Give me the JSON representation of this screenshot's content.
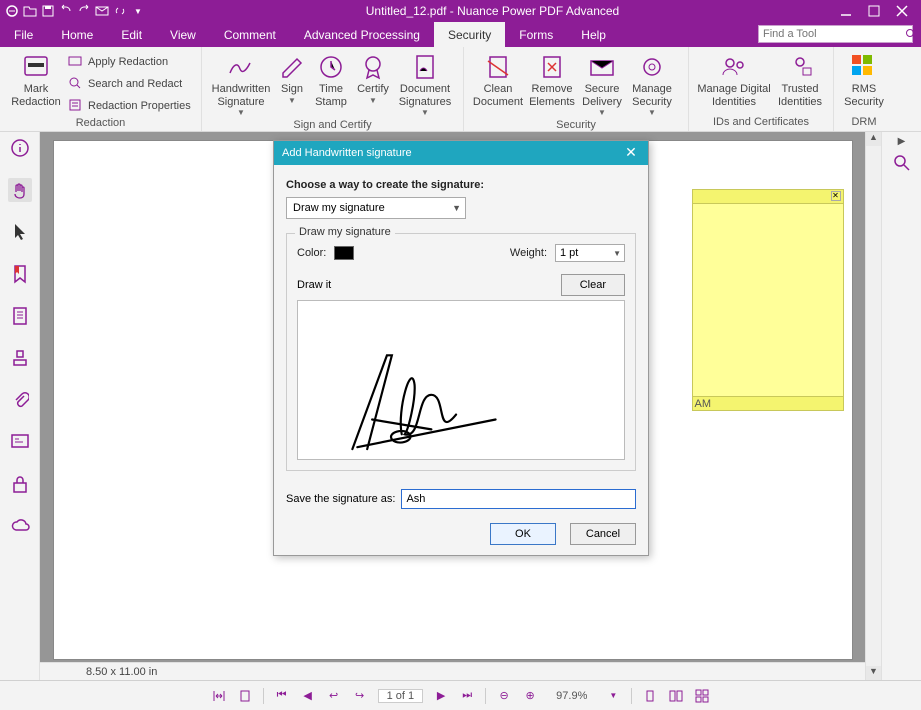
{
  "title": "Untitled_12.pdf - Nuance Power PDF Advanced",
  "menu": [
    "File",
    "Home",
    "Edit",
    "View",
    "Comment",
    "Advanced Processing",
    "Security",
    "Forms",
    "Help"
  ],
  "menu_active": "Security",
  "search_placeholder": "Find a Tool",
  "ribbon": {
    "redaction": {
      "title": "Redaction",
      "mark": "Mark\nRedaction",
      "apply": "Apply Redaction",
      "search": "Search and Redact",
      "props": "Redaction Properties"
    },
    "sign": {
      "title": "Sign and Certify",
      "hand": "Handwritten\nSignature",
      "sign": "Sign",
      "stamp": "Time\nStamp",
      "cert": "Certify",
      "docsigs": "Document\nSignatures"
    },
    "security": {
      "title": "Security",
      "clean": "Clean\nDocument",
      "remove": "Remove\nElements",
      "secure": "Secure\nDelivery",
      "manage": "Manage\nSecurity"
    },
    "ids": {
      "title": "IDs and Certificates",
      "digital": "Manage Digital\nIdentities",
      "trusted": "Trusted\nIdentities"
    },
    "drm": {
      "title": "DRM",
      "rms": "RMS\nSecurity"
    }
  },
  "note_time": "AM",
  "dims": "8.50 x 11.00 in",
  "status": {
    "page": "1 of 1",
    "zoom": "97.9%"
  },
  "dialog": {
    "title": "Add Handwritten signature",
    "choose": "Choose a way to create the signature:",
    "method": "Draw my signature",
    "fieldset": "Draw my signature",
    "color_label": "Color:",
    "weight_label": "Weight:",
    "weight": "1 pt",
    "drawit": "Draw it",
    "clear": "Clear",
    "save_label": "Save the signature as:",
    "save_value": "Ash",
    "ok": "OK",
    "cancel": "Cancel"
  }
}
